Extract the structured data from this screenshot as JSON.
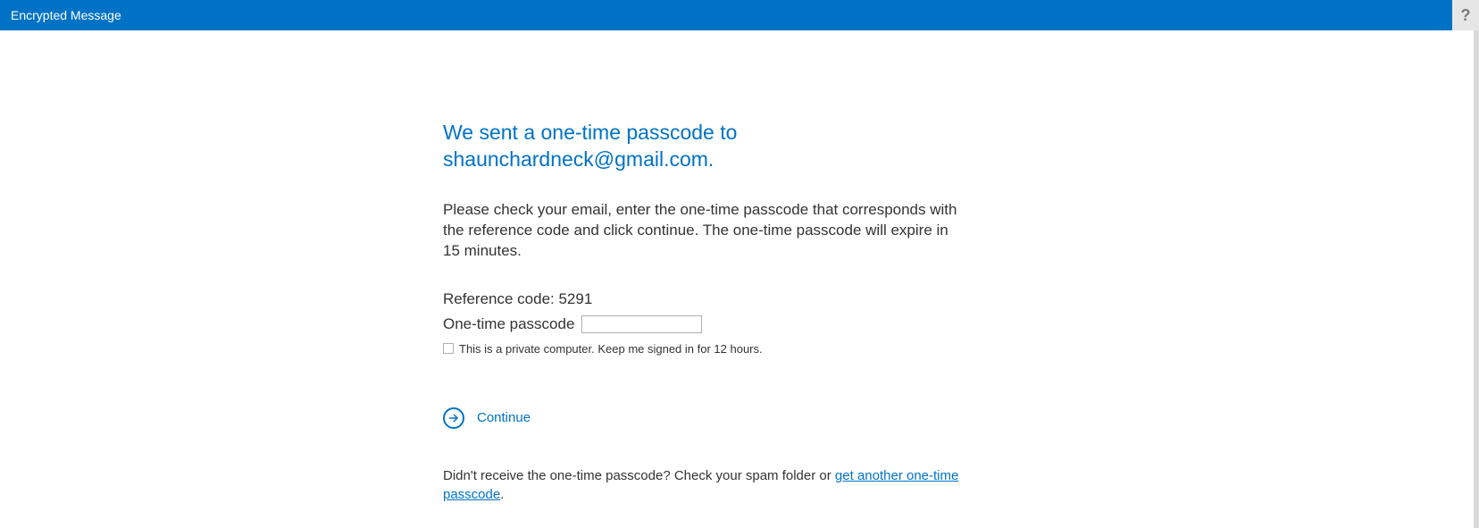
{
  "header": {
    "title": "Encrypted Message",
    "help_label": "?"
  },
  "main": {
    "heading": "We sent a one-time passcode to shaunchardneck@gmail.com.",
    "instructions": "Please check your email, enter the one-time passcode that corresponds with the reference code and click continue. The one-time passcode will expire in 15 minutes.",
    "reference_code_label": "Reference code: 5291",
    "passcode_label": "One-time passcode",
    "passcode_value": "",
    "checkbox_label": "This is a private computer. Keep me signed in for 12 hours.",
    "continue_label": "Continue",
    "footer_prefix": "Didn't receive the one-time passcode? Check your spam folder or ",
    "footer_link": "get another one-time passcode",
    "footer_suffix": "."
  }
}
